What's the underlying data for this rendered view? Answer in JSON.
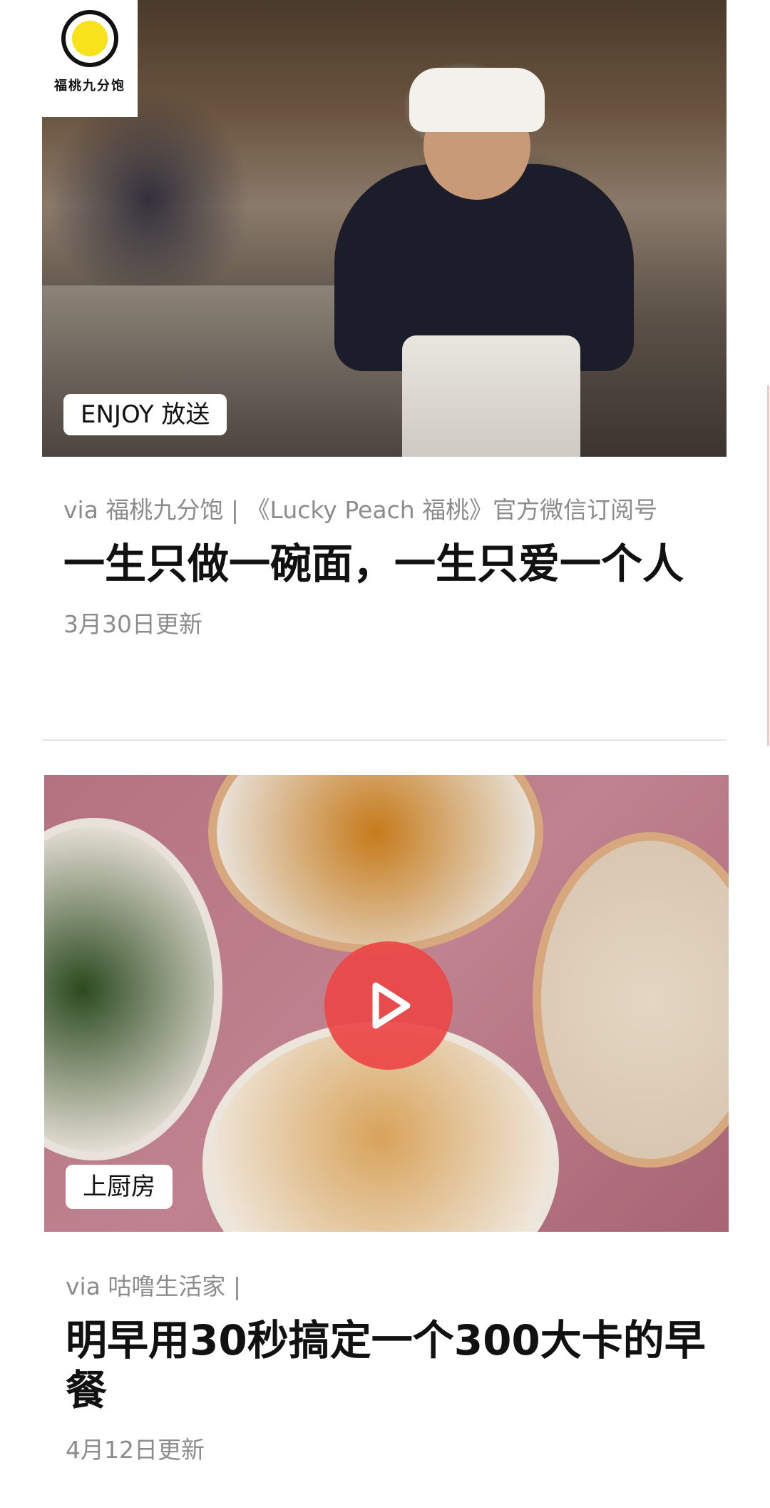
{
  "feed": {
    "items": [
      {
        "media": {
          "logo_text": "福桃九分饱",
          "image_description": "photo-chef-kitchen"
        },
        "category": "ENJOY 放送",
        "source": "via 福桃九分饱 | 《Lucky Peach 福桃》官方微信订阅号",
        "title": "一生只做一碗面，一生只爱一个人",
        "updated": "3月30日更新"
      },
      {
        "media": {
          "image_description": "photo-oatmeal-bowls",
          "has_video": true
        },
        "category": "上厨房",
        "source": "via 咕噜生活家 |",
        "title": "明早用30秒搞定一个300大卡的早餐",
        "updated": "4月12日更新"
      }
    ]
  },
  "colors": {
    "play_button": "#EC4646",
    "meta_text": "#8C8C8C",
    "title_text": "#111111",
    "logo_yellow": "#F7E21C"
  },
  "icons": {
    "play": "play-icon",
    "logo": "lucky-peach-logo-icon"
  }
}
